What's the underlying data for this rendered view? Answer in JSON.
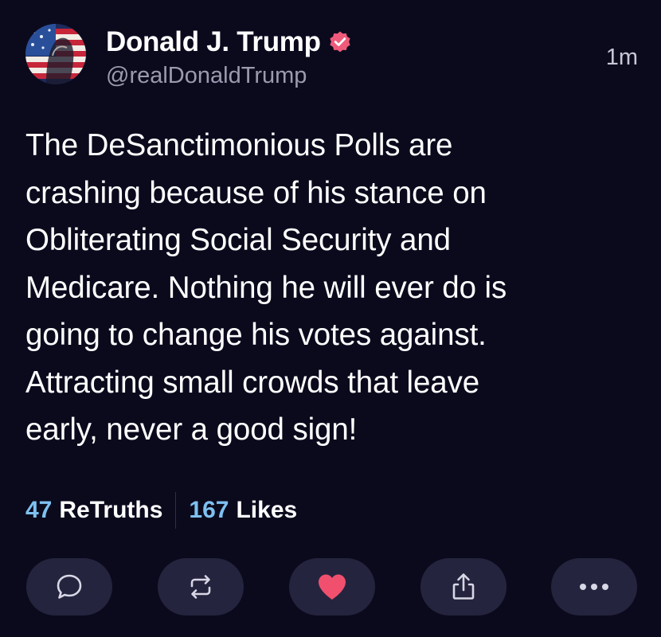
{
  "post": {
    "author": {
      "display_name": "Donald J. Trump",
      "handle": "@realDonaldTrump",
      "verified": true,
      "avatar_icon": "flag-portrait-avatar"
    },
    "timestamp": "1m",
    "body": "The DeSanctimonious Polls are\ncrashing because of his stance on\nObliterating Social Security and\nMedicare. Nothing he will ever do is\ngoing to change his votes against.\nAttracting small crowds that leave\nearly, never a good sign!",
    "stats": {
      "retruths_count": "47",
      "retruths_label": "ReTruths",
      "likes_count": "167",
      "likes_label": "Likes"
    },
    "actions": [
      {
        "name": "reply",
        "icon": "speech-bubble-icon"
      },
      {
        "name": "retruth",
        "icon": "repost-arrows-icon"
      },
      {
        "name": "like",
        "icon": "heart-icon",
        "active": true
      },
      {
        "name": "share",
        "icon": "share-upload-icon"
      },
      {
        "name": "more",
        "icon": "ellipsis-icon"
      }
    ]
  },
  "colors": {
    "background": "#0b0a1d",
    "accent_blue": "#7ec1f1",
    "verified_badge": "#f05a7a",
    "like_heart": "#f0506e",
    "action_pill": "#25243e",
    "secondary_text": "#9b9aae"
  }
}
